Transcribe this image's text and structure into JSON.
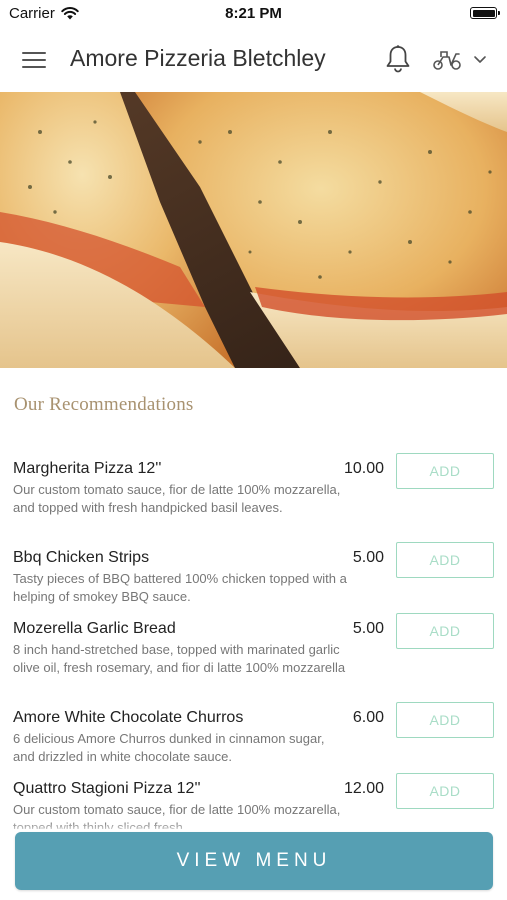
{
  "status_bar": {
    "carrier": "Carrier",
    "time": "8:21 PM"
  },
  "header": {
    "title": "Amore Pizzeria Bletchley",
    "icons": [
      "menu-icon",
      "bell-icon",
      "scooter-icon",
      "chevron-down-icon"
    ]
  },
  "hero": {
    "image": "pizza-slices-photo"
  },
  "recommendations": {
    "title": "Our Recommendations",
    "add_label": "ADD",
    "items": [
      {
        "name": "Margherita Pizza 12''",
        "description": "Our custom tomato sauce, fior de latte 100% mozzarella, and topped with fresh handpicked basil leaves.",
        "price": "10.00"
      },
      {
        "name": "Bbq Chicken Strips",
        "description": "Tasty pieces of BBQ battered 100% chicken topped with a helping of smokey BBQ sauce.",
        "price": "5.00"
      },
      {
        "name": "Mozerella Garlic Bread",
        "description": "8 inch hand-stretched base, topped with marinated garlic olive oil, fresh rosemary, and fior di latte 100% mozzarella",
        "price": "5.00"
      },
      {
        "name": "Amore White Chocolate Churros",
        "description": "6 delicious Amore Churros dunked in cinnamon sugar, and drizzled in white chocolate sauce.",
        "price": "6.00"
      },
      {
        "name": "Quattro Stagioni Pizza 12''",
        "description": "Our custom tomato sauce, fior de latte 100% mozzarella, topped with thinly sliced fresh",
        "price": "12.00"
      }
    ]
  },
  "view_menu_label": "VIEW MENU",
  "colors": {
    "accent_blue": "#569fb3",
    "add_border": "#9ed9c0",
    "section_title": "#a89270"
  }
}
